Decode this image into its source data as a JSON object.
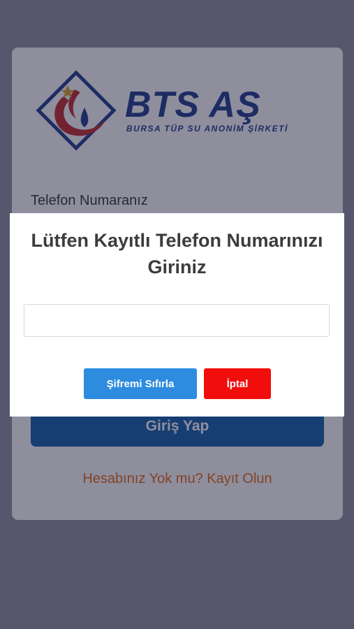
{
  "brand": {
    "name": "BTS AŞ",
    "subtitle": "BURSA TÜP SU ANONİM ŞİRKETİ",
    "primary_color": "#1d3a8a",
    "accent_color": "#c62828"
  },
  "login": {
    "phone_label": "Telefon Numaranız",
    "login_button": "Giriş Yap",
    "register_link": "Hesabınız Yok mu? Kayıt Olun"
  },
  "modal": {
    "title": "Lütfen Kayıtlı Telefon Numarınızı Giriniz",
    "input_value": "",
    "input_placeholder": "",
    "reset_button": "Şifremi Sıfırla",
    "cancel_button": "İptal"
  }
}
